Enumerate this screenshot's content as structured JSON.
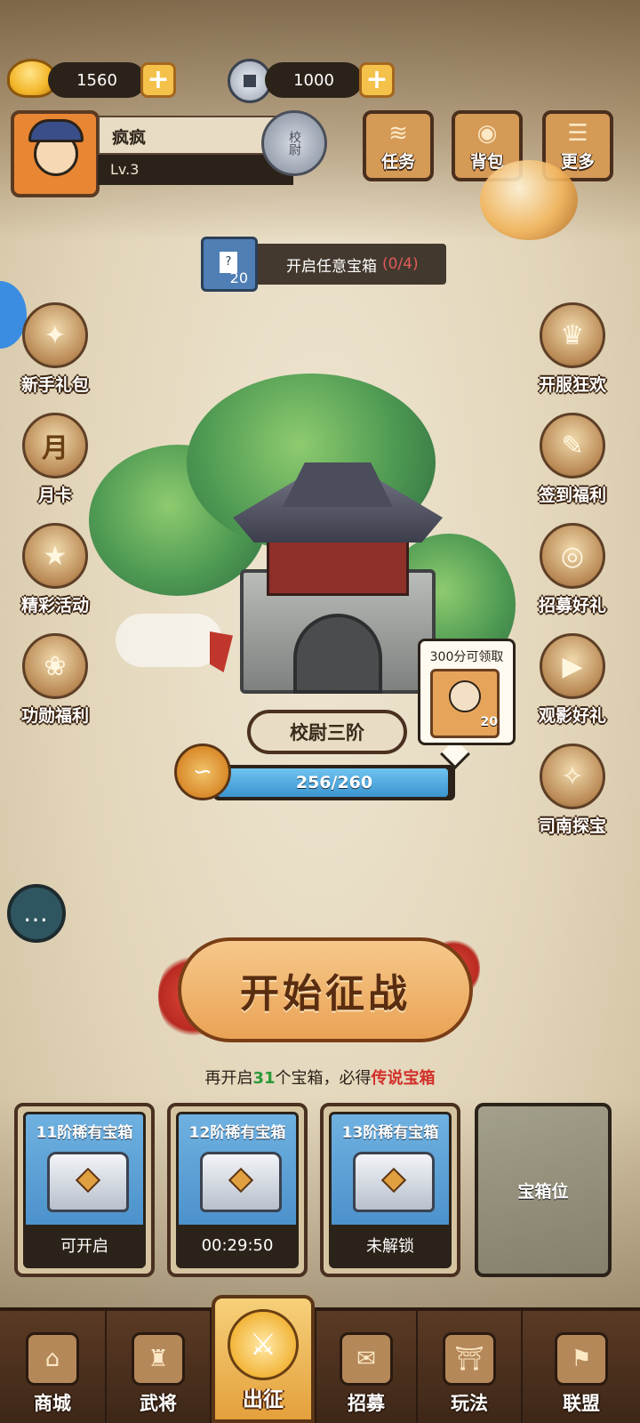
{
  "currency": {
    "gold": {
      "icon": "gold-ingot-icon",
      "value": "1560"
    },
    "coin": {
      "icon": "copper-coin-icon",
      "value": "1000"
    },
    "plus_label": "+"
  },
  "profile": {
    "name": "疯疯",
    "level": "Lv.3",
    "rank": "校尉"
  },
  "top_buttons": [
    {
      "label": "任务",
      "icon": "scroll-icon"
    },
    {
      "label": "背包",
      "icon": "bag-icon"
    },
    {
      "label": "更多",
      "icon": "menu-icon"
    }
  ],
  "quest": {
    "text": "开启任意宝箱",
    "progress": "(0/4)",
    "reward_count": "20",
    "reward_mark": "?"
  },
  "left_side": [
    {
      "label": "新手礼包",
      "icon": "hero-gift-icon"
    },
    {
      "label": "月卡",
      "icon": "month-card-icon",
      "glyph": "月"
    },
    {
      "label": "精彩活动",
      "icon": "activity-bag-icon"
    },
    {
      "label": "功勋福利",
      "icon": "merit-bag-icon"
    }
  ],
  "right_side": [
    {
      "label": "开服狂欢",
      "icon": "carnival-icon"
    },
    {
      "label": "签到福利",
      "icon": "sign-in-icon"
    },
    {
      "label": "招募好礼",
      "icon": "recruit-drum-icon"
    },
    {
      "label": "观影好礼",
      "icon": "video-gift-icon"
    },
    {
      "label": "司南探宝",
      "icon": "compass-icon"
    }
  ],
  "stage": {
    "name": "校尉三阶",
    "current": 256,
    "max": 260,
    "progress_text": "256/260",
    "reward_bubble": "300分可领取",
    "reward_count": "20"
  },
  "battle": {
    "label": "开始征战",
    "hint_prefix": "再开启",
    "hint_count": "31",
    "hint_mid": "个宝箱，必得",
    "hint_reward": "传说宝箱"
  },
  "chests": [
    {
      "title": "11阶稀有宝箱",
      "status": "可开启"
    },
    {
      "title": "12阶稀有宝箱",
      "status": "00:29:50"
    },
    {
      "title": "13阶稀有宝箱",
      "status": "未解锁"
    }
  ],
  "empty_slot": "宝箱位",
  "nav": [
    {
      "label": "商城",
      "icon": "shop-icon"
    },
    {
      "label": "武将",
      "icon": "helmet-icon"
    },
    {
      "label": "出征",
      "icon": "battle-icon",
      "active": true
    },
    {
      "label": "招募",
      "icon": "recruit-scroll-icon"
    },
    {
      "label": "玩法",
      "icon": "pavilion-icon"
    },
    {
      "label": "联盟",
      "icon": "alliance-flag-icon"
    }
  ],
  "colors": {
    "accent_gold": "#f4c24a",
    "progress_blue": "#3a94d0",
    "hint_green": "#2a9a3a",
    "hint_red": "#d2302a"
  }
}
